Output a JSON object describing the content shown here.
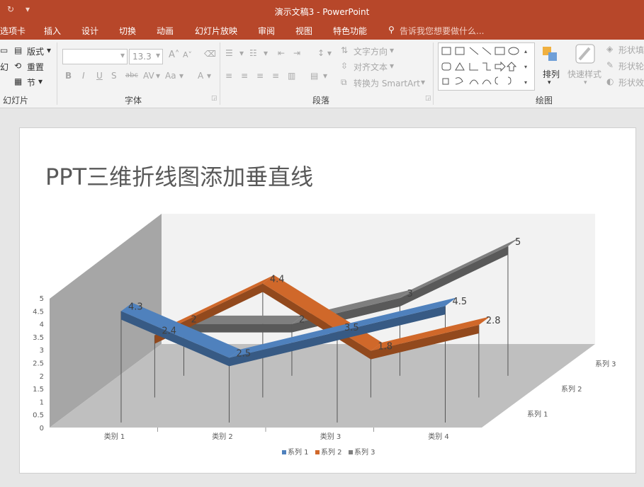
{
  "window": {
    "title": "演示文稿3 - PowerPoint"
  },
  "menu": {
    "items": [
      "选项卡",
      "插入",
      "设计",
      "切换",
      "动画",
      "幻灯片放映",
      "审阅",
      "视图",
      "特色功能"
    ],
    "tell_me": "告诉我您想要做什么..."
  },
  "ribbon": {
    "slides": {
      "layout": "版式",
      "reset": "重置",
      "section": "节",
      "group": "幻灯片"
    },
    "font": {
      "size": "13.3",
      "group": "字体"
    },
    "paragraph": {
      "text_direction": "文字方向",
      "align_text": "对齐文本",
      "smartart": "转换为 SmartArt",
      "group": "段落"
    },
    "drawing": {
      "arrange": "排列",
      "quick_styles": "快速样式",
      "fill": "形状填",
      "outline": "形状轮",
      "effects": "形状效",
      "group": "绘图"
    }
  },
  "slide": {
    "title": "PPT三维折线图添加垂直线"
  },
  "chart_data": {
    "type": "line",
    "subtype": "3d-line",
    "categories": [
      "类别 1",
      "类别 2",
      "类别 3",
      "类别 4"
    ],
    "series": [
      {
        "name": "系列 1",
        "values": [
          4.3,
          2.5,
          3.5,
          4.5
        ],
        "color": "#4f81bd"
      },
      {
        "name": "系列 2",
        "values": [
          2.4,
          4.4,
          1.8,
          2.8
        ],
        "color": "#d0682a"
      },
      {
        "name": "系列 3",
        "values": [
          2,
          2,
          3,
          5
        ],
        "color": "#7f7f7f"
      }
    ],
    "ytick_labels": [
      "0",
      "0.5",
      "1",
      "1.5",
      "2",
      "2.5",
      "3",
      "3.5",
      "4",
      "4.5",
      "5"
    ],
    "ylim": [
      0,
      5
    ],
    "depth_labels": [
      "系列 1",
      "系列 2",
      "系列 3"
    ],
    "drop_lines": true,
    "data_labels": true,
    "legend_position": "bottom"
  }
}
